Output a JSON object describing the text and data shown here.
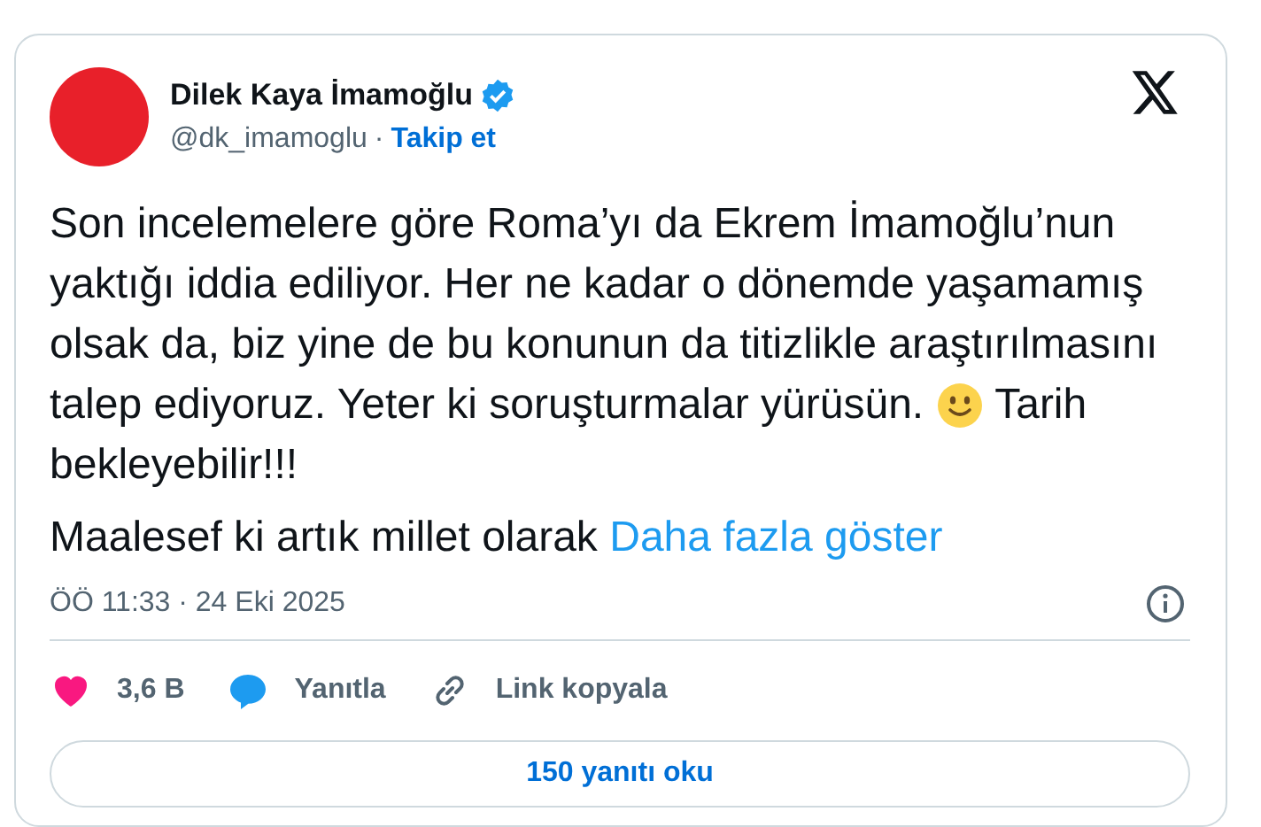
{
  "author": {
    "name": "Dilek Kaya İmamoğlu",
    "verified": true,
    "handle": "@dk_imamoglu",
    "separator": "·",
    "follow": "Takip et"
  },
  "tweet": {
    "lines": [
      {
        "kind": "text",
        "text": "Son incelemelere göre Roma’yı da Ekrem İmamoğlu’nun"
      },
      {
        "kind": "text",
        "text": "yaktığı iddia ediliyor. Her ne kadar o dönemde yaşamamış"
      },
      {
        "kind": "text",
        "text": "olsak da, biz yine de bu konunun da titizlikle araştırılmasını"
      },
      {
        "kind": "emoji",
        "before": "talep ediyoruz. Yeter ki soruşturmalar yürüsün.",
        "after": "Tarih"
      },
      {
        "kind": "text",
        "text": "bekleyebilir!!!"
      }
    ],
    "second_paragraph": "Maalesef ki artık millet olarak",
    "show_more": "Daha fazla göster"
  },
  "timestamp": "ÖÖ 11:33 · 24 Eki 2025",
  "actions": [
    {
      "kind": "like",
      "label": "3,6 B"
    },
    {
      "kind": "reply",
      "label": "Yanıtla"
    },
    {
      "kind": "copy_link",
      "label": "Link kopyala"
    }
  ],
  "replies_button": "150 yanıtı oku"
}
